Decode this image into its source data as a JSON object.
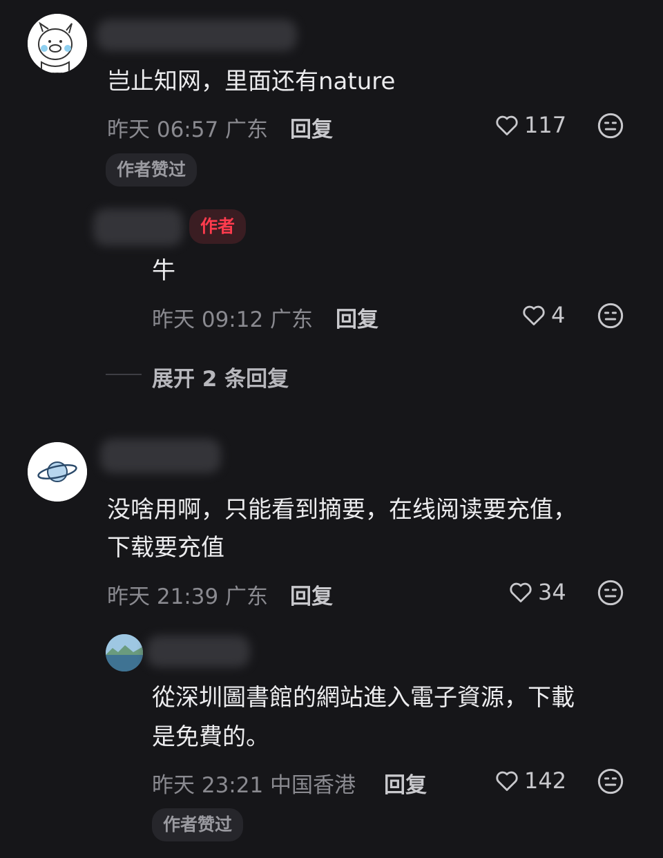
{
  "comments": [
    {
      "text": "岂止知网，里面还有nature",
      "time": "昨天 06:57 广东",
      "reply_label": "回复",
      "likes": "117",
      "badge": "作者赞过",
      "avatar_icon": "pig-cartoon-avatar"
    },
    {
      "author_tag": "作者",
      "text": "牛",
      "time": "昨天 09:12 广东",
      "reply_label": "回复",
      "likes": "4"
    },
    {
      "expand_label": "展开 2 条回复"
    },
    {
      "text_line1": "没啥用啊，只能看到摘要，在线阅读要充值，",
      "text_line2": "下载要充值",
      "time": "昨天 21:39 广东",
      "reply_label": "回复",
      "likes": "34",
      "avatar_icon": "planet-avatar"
    },
    {
      "text_line1": "從深圳圖書館的網站進入電子資源，下載",
      "text_line2": "是免費的。",
      "time": "昨天 23:21 中国香港",
      "reply_label": "回复",
      "likes": "142",
      "badge": "作者赞过",
      "avatar_icon": "landscape-photo-avatar"
    }
  ]
}
